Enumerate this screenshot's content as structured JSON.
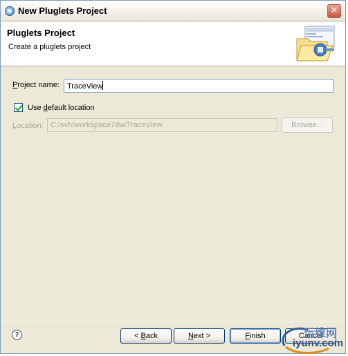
{
  "window": {
    "title": "New Pluglets Project",
    "close_glyph": "✕"
  },
  "banner": {
    "title": "Pluglets Project",
    "description": "Create a pluglets project",
    "icon": "folder-plug-icon"
  },
  "form": {
    "project_name_label_pre": "P",
    "project_name_label_post": "roject name:",
    "project_name_value": "TraceView",
    "use_default_label_pre": "Use ",
    "use_default_label_u": "d",
    "use_default_label_post": "efault location",
    "use_default_checked": true,
    "location_label_pre": "L",
    "location_label_post": "ocation:",
    "location_value": "C:/svh/workspace7dw/TraceView",
    "browse_label": "Browse..."
  },
  "buttons": {
    "help_glyph": "?",
    "back_pre": "< ",
    "back_u": "B",
    "back_post": "ack",
    "next_u": "N",
    "next_post": "ext >",
    "finish_u": "F",
    "finish_post": "inish",
    "cancel": "Cancel"
  },
  "watermark": {
    "line1": "运维网",
    "line2": "iyunv.com"
  },
  "colors": {
    "dialog_bg": "#ece9d8",
    "field_border": "#7f9db9",
    "check_green": "#21a121"
  }
}
